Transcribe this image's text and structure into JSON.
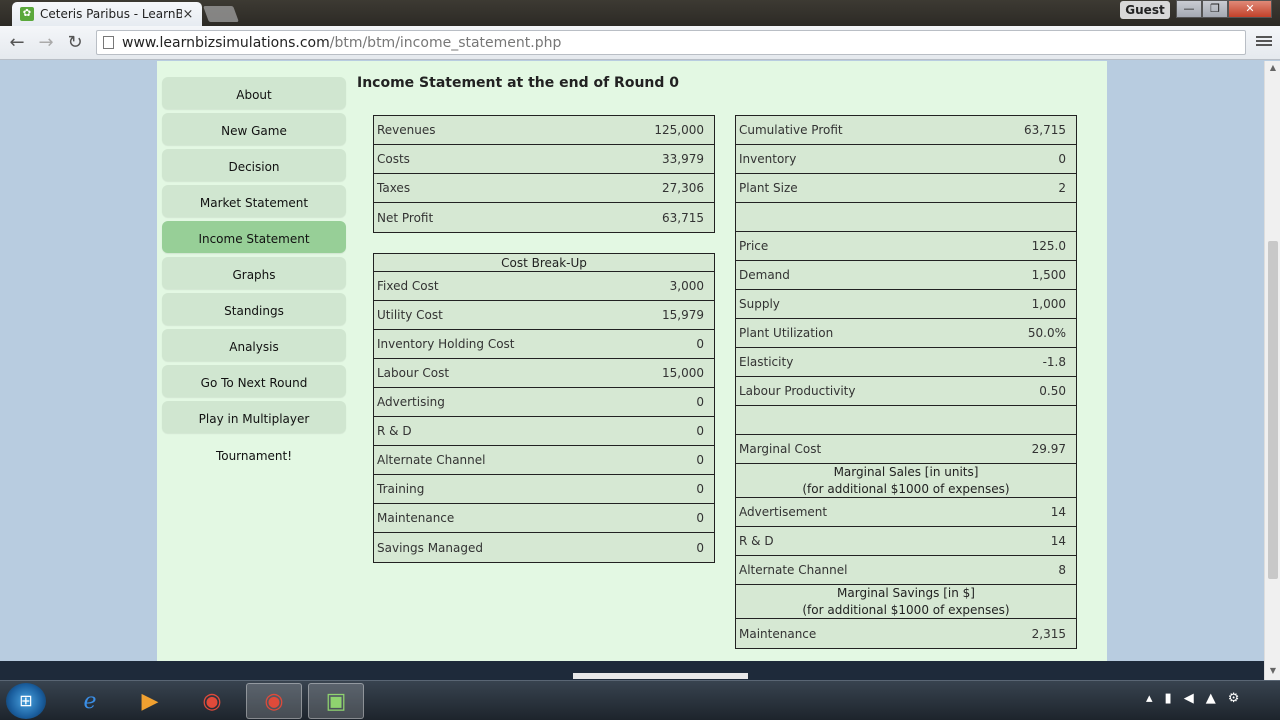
{
  "browser": {
    "tab_title": "Ceteris Paribus - LearnBiz",
    "tab_close": "×",
    "guest_label": "Guest",
    "url_host": "www.learnbizsimulations.com",
    "url_path": "/btm/btm/income_statement.php",
    "back": "←",
    "forward": "→",
    "reload": "↻",
    "win_min": "—",
    "win_max": "❐",
    "win_close": "✕"
  },
  "sidebar": {
    "items": [
      {
        "label": "About"
      },
      {
        "label": "New Game"
      },
      {
        "label": "Decision"
      },
      {
        "label": "Market Statement"
      },
      {
        "label": "Income Statement",
        "active": true
      },
      {
        "label": "Graphs"
      },
      {
        "label": "Standings"
      },
      {
        "label": "Analysis"
      },
      {
        "label": "Go To Next Round"
      },
      {
        "label": "Play in Multiplayer Tournament!"
      }
    ]
  },
  "page_title": "Income Statement at the end of Round 0",
  "summary": [
    {
      "label": "Revenues",
      "value": "125,000"
    },
    {
      "label": "Costs",
      "value": "33,979"
    },
    {
      "label": "Taxes",
      "value": "27,306"
    },
    {
      "label": "Net Profit",
      "value": "63,715"
    }
  ],
  "cost_breakup": {
    "title": "Cost Break-Up",
    "rows": [
      {
        "label": "Fixed Cost",
        "value": "3,000"
      },
      {
        "label": "Utility Cost",
        "value": "15,979"
      },
      {
        "label": "Inventory Holding Cost",
        "value": "0"
      },
      {
        "label": "Labour Cost",
        "value": "15,000"
      },
      {
        "label": "Advertising",
        "value": "0"
      },
      {
        "label": "R & D",
        "value": "0"
      },
      {
        "label": "Alternate Channel",
        "value": "0"
      },
      {
        "label": "Training",
        "value": "0"
      },
      {
        "label": "Maintenance",
        "value": "0"
      },
      {
        "label": "Savings Managed",
        "value": "0"
      }
    ]
  },
  "right_panel": {
    "top": [
      {
        "label": "Cumulative Profit",
        "value": "63,715"
      },
      {
        "label": "Inventory",
        "value": "0"
      },
      {
        "label": "Plant Size",
        "value": "2"
      },
      {
        "label": "",
        "value": ""
      },
      {
        "label": "Price",
        "value": "125.0"
      },
      {
        "label": "Demand",
        "value": "1,500"
      },
      {
        "label": "Supply",
        "value": "1,000"
      },
      {
        "label": "Plant Utilization",
        "value": "50.0%"
      },
      {
        "label": "Elasticity",
        "value": "-1.8"
      },
      {
        "label": "Labour Productivity",
        "value": "0.50"
      },
      {
        "label": "",
        "value": ""
      },
      {
        "label": "Marginal Cost",
        "value": "29.97"
      }
    ],
    "marginal_sales_header": {
      "line1": "Marginal Sales [in units]",
      "line2": "(for additional $1000 of expenses)"
    },
    "marginal_sales": [
      {
        "label": "Advertisement",
        "value": "14"
      },
      {
        "label": "R & D",
        "value": "14"
      },
      {
        "label": "Alternate Channel",
        "value": "8"
      }
    ],
    "marginal_savings_header": {
      "line1": "Marginal Savings [in $]",
      "line2": "(for additional $1000 of expenses)"
    },
    "marginal_savings": [
      {
        "label": "Maintenance",
        "value": "2,315"
      }
    ]
  },
  "colors": {
    "content_bg": "#e3f8e3",
    "nav_bg": "#d0e6d0",
    "nav_active": "#97cf97",
    "table_bg": "#d6e8d3",
    "page_bg": "#b8cce0"
  }
}
